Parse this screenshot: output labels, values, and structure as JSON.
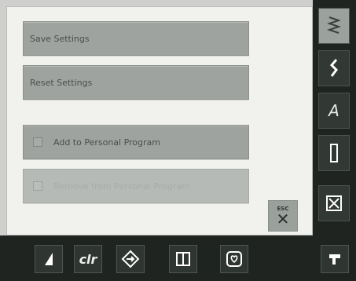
{
  "menu": {
    "save_settings": "Save Settings",
    "reset_settings": "Reset Settings",
    "add_personal": "Add to Personal Program",
    "disabled_item": "Remove from Personal Program"
  },
  "esc": {
    "label": "ESC"
  },
  "colors": {
    "screen_bg": "#f1f1ee",
    "button_bg": "#9ea39f",
    "bar_bg": "#1f2420"
  }
}
